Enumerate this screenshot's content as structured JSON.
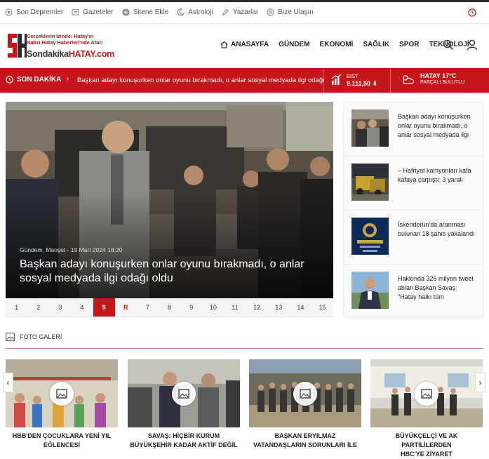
{
  "topbar": {
    "links": [
      {
        "label": "Son Depremler",
        "icon": "pin-icon"
      },
      {
        "label": "Gazeteler",
        "icon": "newspaper-icon"
      },
      {
        "label": "Sitene Ekle",
        "icon": "plus-circle-icon"
      },
      {
        "label": "Astroloji",
        "icon": "moon-icon"
      },
      {
        "label": "Yazarlar",
        "icon": "pen-icon"
      },
      {
        "label": "Bize Ulaşın",
        "icon": "at-icon"
      }
    ]
  },
  "logo": {
    "tagline1": "Gerçeklerin İzinde: Hatay'ın",
    "tagline2": "Nabzı Hatay Haberleri'nde Atar!",
    "brand1": "Sondakika",
    "brand2": "HATAY.com"
  },
  "nav": {
    "items": [
      "ANASAYFA",
      "GÜNDEM",
      "EKONOMİ",
      "SAĞLIK",
      "SPOR",
      "TEKNOLOJİ"
    ]
  },
  "breaking": {
    "label": "SON DAKİKA",
    "sep": "›",
    "headline": "Başkan adayı konuşurken onlar oyunu bırakmadı, o anlar sosyal medyada ilgi odağı",
    "bist_label": "BIST",
    "bist_value": "9.111,50 ⬇",
    "weather_city": "HATAY 17°C",
    "weather_desc": "PARÇALI BULUTLU",
    "weather_chev": "⌄"
  },
  "slider": {
    "meta": "Gündem, Manşet  -  19 Mart 2024 18:20",
    "title": "Başkan adayı konuşurken onlar oyunu bırakmadı, o anlar sosyal medyada ilgi odağı oldu",
    "pages": [
      "1",
      "2",
      "3",
      "4",
      "5",
      "R",
      "7",
      "8",
      "9",
      "10",
      "11",
      "12",
      "13",
      "14",
      "15"
    ],
    "active_page": "5"
  },
  "side": {
    "items": [
      "Başkan adayı konuşurken onlar oyunu bırakmadı, o anlar sosyal medyada ilgi odağı oldu",
      "– Hafriyat kamyonları kafa kafaya çarpıştı: 3 yaralı",
      "İskenderun'da aranması bulunan 18 şahıs yakalandı",
      "Hakkında 326 milyon tweet atılan Başkan Savaş: \"Hatay halkı tüm"
    ]
  },
  "gallery": {
    "heading": "FOTO GALERİ",
    "prev": "‹",
    "next": "›",
    "cards": [
      {
        "line1": "HBB'DEN ÇOCUKLARA YENİ YIL",
        "line2": "EĞLENCESİ"
      },
      {
        "line1": "SAVAŞ: HİÇBİR KURUM",
        "line2": "BÜYÜKŞEHİR KADAR AKTİF DEĞİL"
      },
      {
        "line1": "BAŞKAN ERYILMAZ",
        "line2": "VATANDAŞLARIN SORUNLARI İLE"
      },
      {
        "line1": "BÜYÜKÇELÇİ VE AK PARTİLİLERDEN",
        "line2": "HBC'YE ZİYARET"
      }
    ]
  },
  "colors": {
    "accent": "#c4161c",
    "dark": "#2b2b2b"
  }
}
